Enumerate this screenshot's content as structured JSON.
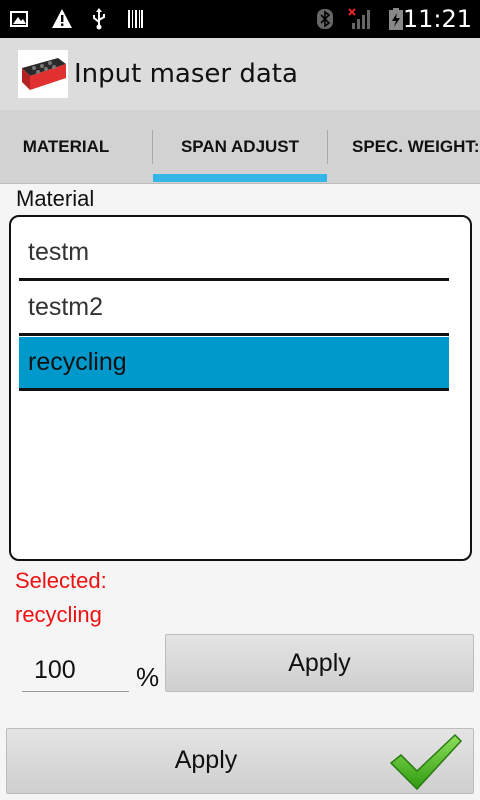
{
  "status_bar": {
    "time": "11:21",
    "icons": [
      "image-notification-icon",
      "warning-icon",
      "usb-icon",
      "barcode-icon",
      "bluetooth-icon",
      "no-signal-icon",
      "battery-charging-icon"
    ],
    "background": "#000000"
  },
  "action_bar": {
    "title": "Input maser data",
    "icon": "app-logo-icon",
    "background": "#dcdcdc"
  },
  "tabs": {
    "items": [
      {
        "label": "MATERIAL",
        "selected": false
      },
      {
        "label": "SPAN ADJUST",
        "selected": true
      },
      {
        "label": "SPEC. WEIGHT:",
        "selected": false
      }
    ],
    "indicator_color": "#33b5e5"
  },
  "material_section": {
    "label": "Material",
    "items": [
      "testm",
      "testm2",
      "recycling"
    ],
    "selected_index": 2,
    "selected_color": "#0099cc"
  },
  "selection_status": {
    "prefix": "Selected:",
    "value": "recycling",
    "color": "#ee1111"
  },
  "span_adjust": {
    "value": "100",
    "unit": "%",
    "apply_label": "Apply"
  },
  "footer": {
    "apply_label": "Apply",
    "check_icon": "green-checkmark-icon",
    "check_color": "#4cc51a"
  }
}
